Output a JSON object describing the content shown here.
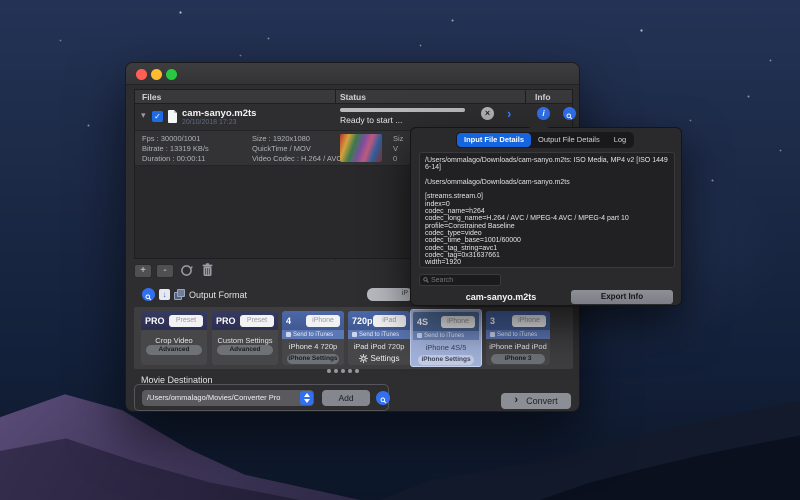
{
  "window": {
    "table": {
      "headers": {
        "files": "Files",
        "status": "Status",
        "info": "Info"
      },
      "row": {
        "name": "cam-sanyo.m2ts",
        "date": "20/10/2018 17:23",
        "status": "Ready to start ...",
        "details_col1": [
          "Fps : 30000/1001",
          "Bitrate : 13319 KB/s",
          "Duration : 00:00:11"
        ],
        "details_col2": [
          "Size : 1920x1080",
          "QuickTime / MOV",
          "Video Codec : H.264 / AVC"
        ],
        "details_col3": [
          "Siz",
          "V",
          "0"
        ]
      }
    },
    "toolbar": {
      "add": "+",
      "remove": "-"
    },
    "output_format": {
      "label": "Output Format",
      "selected_fragment": "iP"
    },
    "presets": [
      {
        "badge": "PRO",
        "field": "Preset",
        "label": "Crop Video",
        "button": "Advanced"
      },
      {
        "badge": "PRO",
        "field": "Preset",
        "label": "Custom Settings",
        "button": "Advanced"
      },
      {
        "badge": "4",
        "field": "iPhone",
        "itunes": "Send to iTunes",
        "label": "iPhone 4 720p",
        "button": "iPhone Settings"
      },
      {
        "badge": "720p",
        "field": "iPad",
        "itunes": "Send to iTunes",
        "label": "iPad iPod 720p",
        "button": "Settings"
      },
      {
        "badge": "4S",
        "field": "iPhone",
        "itunes": "Send to iTunes",
        "label": "iPhone 4S/5",
        "button": "iPhone Settings",
        "selected": true
      },
      {
        "badge": "3",
        "field": "iPhone",
        "itunes": "Send to iTunes",
        "label": "iPhone iPad iPod",
        "button": "iPhone 3"
      }
    ],
    "pager_dots": 5,
    "movie_destination": {
      "label": "Movie Destination",
      "path": "/Users/ommalago/Movies/Converter Pro",
      "add": "Add",
      "convert": "Convert"
    }
  },
  "popup": {
    "tabs": [
      {
        "label": "Input File Details",
        "active": true
      },
      {
        "label": "Output File Details",
        "active": false
      },
      {
        "label": "Log",
        "active": false
      }
    ],
    "lines": [
      "/Users/ommalago/Downloads/cam-sanyo.m2ts: ISO Media, MP4 v2 [ISO 14496-14]",
      "",
      "/Users/ommalago/Downloads/cam-sanyo.m2ts",
      "",
      "[streams.stream.0]",
      "index=0",
      "codec_name=h264",
      "codec_long_name=H.264 / AVC / MPEG-4 AVC / MPEG-4 part 10",
      "profile=Constrained Baseline",
      "codec_type=video",
      "codec_time_base=1001/60000",
      "codec_tag_string=avc1",
      "codec_tag=0x31637661",
      "width=1920"
    ],
    "search_placeholder": "Search",
    "file_name": "cam-sanyo.m2ts",
    "export_button": "Export Info"
  },
  "colors": {
    "accent_blue": "#3170ee",
    "tab_blue": "#1565e0",
    "checkbox_blue": "#1f6be6"
  }
}
